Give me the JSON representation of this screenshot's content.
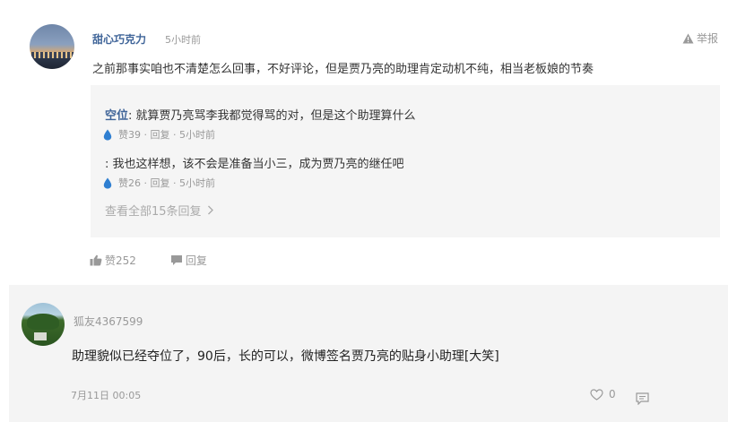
{
  "comment1": {
    "username": "甜心巧克力",
    "time": "5小时前",
    "report_label": "举报",
    "body": "之前那事实咱也不清楚怎么回事，不好评论，但是贾乃亮的助理肯定动机不纯，相当老板娘的节奏",
    "replies": [
      {
        "author": "空位",
        "separator": ":",
        "text": " 就算贾乃亮骂李我都觉得骂的对，但是这个助理算什么",
        "likes": "赞39",
        "reply_label": "回复",
        "time": "5小时前"
      },
      {
        "author": "",
        "separator": ":",
        "text": " 我也这样想，该不会是准备当小三，成为贾乃亮的继任吧",
        "likes": "赞26",
        "reply_label": "回复",
        "time": "5小时前"
      }
    ],
    "view_all": "查看全部15条回复",
    "likes": "赞252",
    "reply_label": "回复"
  },
  "comment2": {
    "username": "狐友4367599",
    "body": "助理貌似已经夺位了，90后，长的可以，微博签名贾乃亮的贴身小助理[大笑]",
    "time": "7月11日 00:05",
    "likes": "0"
  },
  "colors": {
    "username_blue": "#406599",
    "drop_blue": "#2f7fd1",
    "muted": "#999999",
    "reply_bg": "#f5f5f5",
    "card_bg": "#f4f4f4"
  },
  "icons": [
    "warning-icon",
    "water-drop-icon",
    "thumbs-up-icon",
    "speech-bubble-icon",
    "heart-outline-icon",
    "comment-icon",
    "chevron-right-icon"
  ]
}
